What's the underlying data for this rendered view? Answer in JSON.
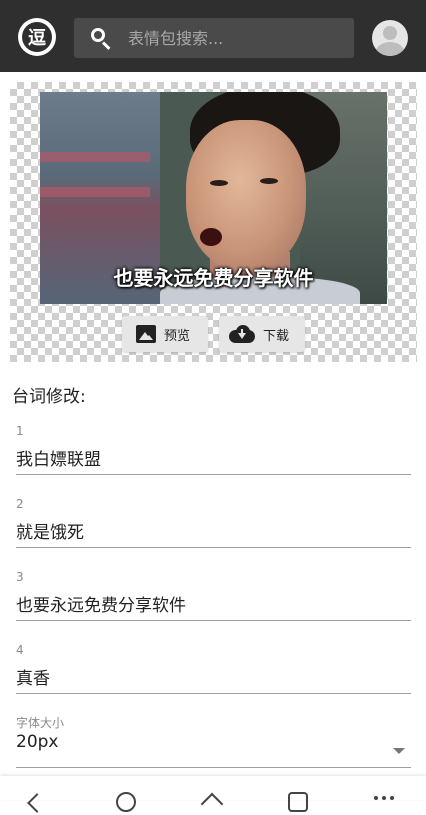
{
  "header": {
    "logo_glyph": "逗",
    "search_placeholder": "表情包搜索..."
  },
  "meme": {
    "caption": "也要永远免费分享软件"
  },
  "actions": {
    "preview_label": "预览",
    "download_label": "下载"
  },
  "editor": {
    "section_title": "台词修改:",
    "lines": [
      {
        "index": "1",
        "text": "我白嫖联盟"
      },
      {
        "index": "2",
        "text": "就是饿死"
      },
      {
        "index": "3",
        "text": "也要永远免费分享软件"
      },
      {
        "index": "4",
        "text": "真香"
      }
    ],
    "font_size": {
      "label": "字体大小",
      "value": "20px"
    }
  },
  "colors": {
    "topbar": "#2f2f2f",
    "search_bg": "#4a4a4a",
    "button_bg": "#e6e6e6"
  },
  "icons": [
    "logo-icon",
    "search-icon",
    "avatar-icon",
    "image-icon",
    "cloud-download-icon",
    "dropdown-caret-icon",
    "back-icon",
    "home-icon",
    "up-icon",
    "tabs-icon",
    "more-icon"
  ]
}
